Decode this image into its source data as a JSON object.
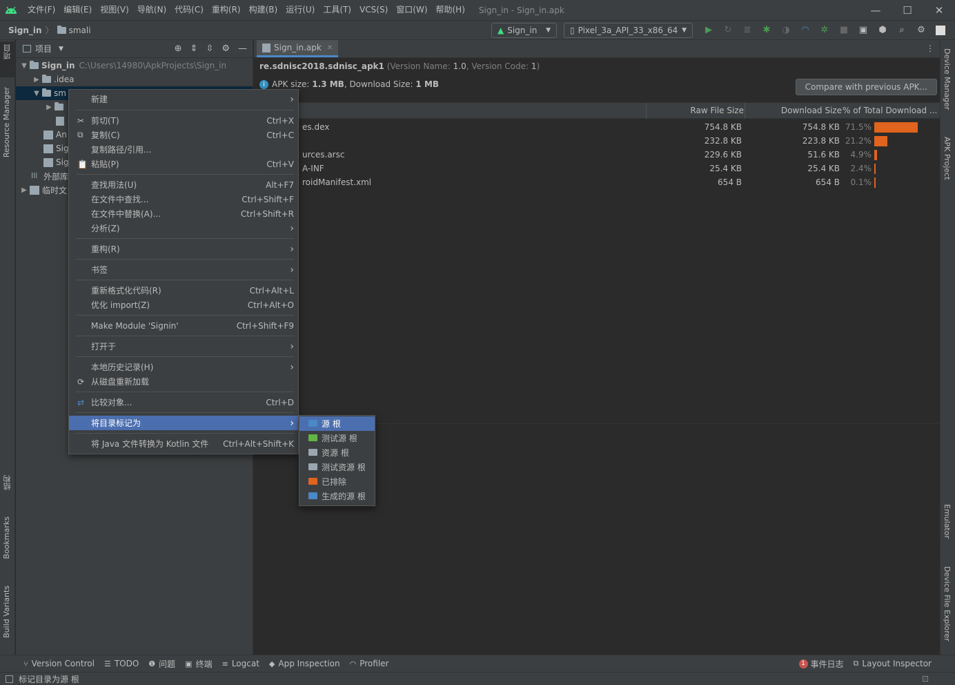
{
  "titlebar": {
    "menus": [
      "文件(F)",
      "编辑(E)",
      "视图(V)",
      "导航(N)",
      "代码(C)",
      "重构(R)",
      "构建(B)",
      "运行(U)",
      "工具(T)",
      "VCS(S)",
      "窗口(W)",
      "帮助(H)"
    ],
    "title": "Sign_in - Sign_in.apk"
  },
  "navbar": {
    "project": "Sign_in",
    "folder": "smali",
    "run_config": "Sign_in",
    "device": "Pixel_3a_API_33_x86_64"
  },
  "left_strip": {
    "project": "项目",
    "resource_manager": "Resource Manager",
    "structure": "结构",
    "bookmarks": "Bookmarks",
    "build_variants": "Build Variants"
  },
  "right_strip": {
    "device_manager": "Device Manager",
    "apk_project": "APK Project",
    "emulator": "Emulator",
    "device_file_explorer": "Device File Explorer"
  },
  "project_panel": {
    "title": "项目",
    "tree": [
      {
        "name": "Sign_in",
        "path": "C:\\Users\\14980\\ApkProjects\\Sign_in"
      },
      {
        "name": ".idea"
      },
      {
        "name": "sm"
      },
      {
        "name": ""
      },
      {
        "name": ""
      },
      {
        "name": "An"
      },
      {
        "name": "Sig"
      },
      {
        "name": "Sig"
      },
      {
        "name": "外部库"
      },
      {
        "name": "临时文"
      }
    ]
  },
  "editor": {
    "tab": "Sign_in.apk",
    "package": "re.sdnisc2018.sdnisc_apk1",
    "version_prefix": "(Version Name:",
    "version_name": "1.0",
    "version_code_prefix": ", Version Code:",
    "version_code": "1",
    "version_suffix": ")",
    "apk_size_label": "APK size:",
    "apk_size": "1.3 MB",
    "download_size_label": ", Download Size:",
    "download_size": "1 MB",
    "compare_button": "Compare with previous APK...",
    "columns": {
      "raw": "Raw File Size",
      "download": "Download Size",
      "pct": "% of Total Download ..."
    },
    "rows": [
      {
        "name": "es.dex",
        "raw": "754.8 KB",
        "download": "754.8 KB",
        "pct": "71.5%",
        "pct_value": 71.5
      },
      {
        "name": "",
        "raw": "232.8 KB",
        "download": "223.8 KB",
        "pct": "21.2%",
        "pct_value": 21.2
      },
      {
        "name": "urces.arsc",
        "raw": "229.6 KB",
        "download": "51.6 KB",
        "pct": "4.9%",
        "pct_value": 4.9
      },
      {
        "name": "A-INF",
        "raw": "25.4 KB",
        "download": "25.4 KB",
        "pct": "2.4%",
        "pct_value": 2.4
      },
      {
        "name": "roidManifest.xml",
        "raw": "654 B",
        "download": "654 B",
        "pct": "0.1%",
        "pct_value": 0.1
      }
    ]
  },
  "context_menu": [
    {
      "label": "新建",
      "shortcut": "",
      "submenu": true,
      "icon": ""
    },
    {
      "label": "剪切(T)",
      "shortcut": "Ctrl+X",
      "icon": "scissors-icon"
    },
    {
      "label": "复制(C)",
      "shortcut": "Ctrl+C",
      "icon": "copy-icon"
    },
    {
      "label": "复制路径/引用...",
      "shortcut": "",
      "icon": ""
    },
    {
      "label": "粘贴(P)",
      "shortcut": "Ctrl+V",
      "icon": "paste-icon"
    },
    {
      "label": "查找用法(U)",
      "shortcut": "Alt+F7"
    },
    {
      "label": "在文件中查找...",
      "shortcut": "Ctrl+Shift+F"
    },
    {
      "label": "在文件中替换(A)...",
      "shortcut": "Ctrl+Shift+R"
    },
    {
      "label": "分析(Z)",
      "shortcut": "",
      "submenu": true
    },
    {
      "label": "重构(R)",
      "shortcut": "",
      "submenu": true
    },
    {
      "label": "书签",
      "shortcut": "",
      "submenu": true
    },
    {
      "label": "重新格式化代码(R)",
      "shortcut": "Ctrl+Alt+L"
    },
    {
      "label": "优化 import(Z)",
      "shortcut": "Ctrl+Alt+O"
    },
    {
      "label": "Make Module 'Signin'",
      "shortcut": "Ctrl+Shift+F9"
    },
    {
      "label": "打开于",
      "shortcut": "",
      "submenu": true
    },
    {
      "label": "本地历史记录(H)",
      "shortcut": "",
      "submenu": true
    },
    {
      "label": "从磁盘重新加载",
      "shortcut": "",
      "icon": "reload-icon"
    },
    {
      "label": "比较对象...",
      "shortcut": "Ctrl+D",
      "icon": "compare-icon"
    },
    {
      "label": "将目录标记为",
      "shortcut": "",
      "submenu": true
    },
    {
      "label": "将 Java 文件转换为 Kotlin 文件",
      "shortcut": "Ctrl+Alt+Shift+K"
    }
  ],
  "submenu": [
    {
      "label": "源 根",
      "color": "#4a88c7"
    },
    {
      "label": "测试源 根",
      "color": "#62b543"
    },
    {
      "label": "资源 根",
      "color": "#9aa7b0"
    },
    {
      "label": "测试资源 根",
      "color": "#9aa7b0"
    },
    {
      "label": "已排除",
      "color": "#e0631e"
    },
    {
      "label": "生成的源 根",
      "color": "#4a88c7"
    }
  ],
  "statusbar": {
    "items": [
      "Version Control",
      "TODO",
      "问题",
      "终端",
      "Logcat",
      "App Inspection",
      "Profiler"
    ],
    "right": [
      "事件日志",
      "Layout Inspector"
    ],
    "event_count": "1",
    "message": "标记目录为源 根"
  },
  "colors": {
    "accent": "#4b6eaf",
    "bar": "#e0631e",
    "android": "#3ddc84"
  }
}
